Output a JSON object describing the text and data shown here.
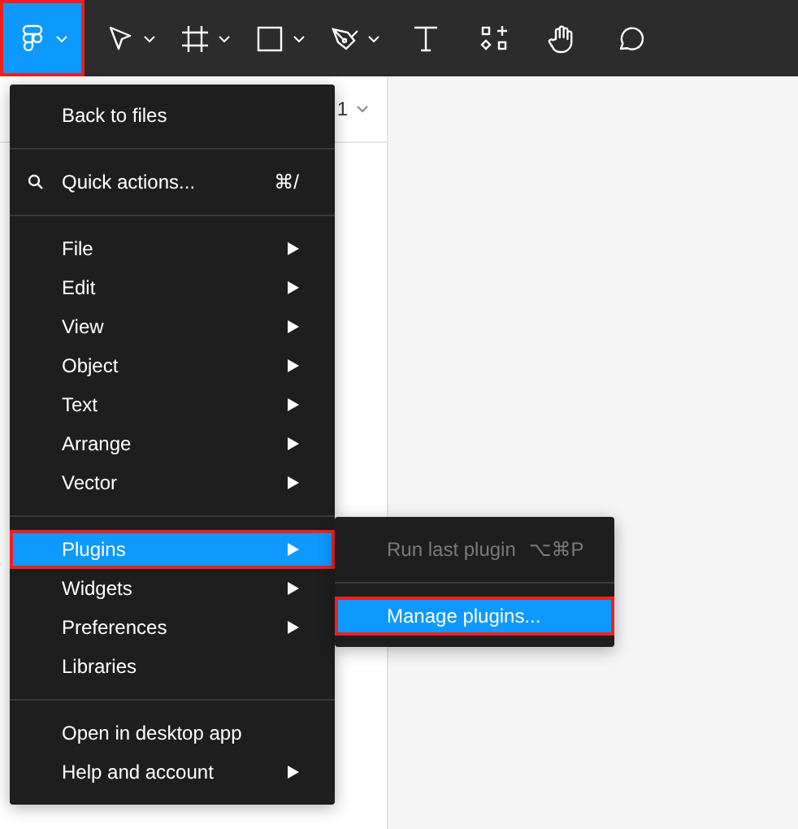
{
  "toolbar": {
    "tools": [
      {
        "kind": "logo",
        "has_menu": true,
        "selected": true,
        "annotated": true
      },
      {
        "kind": "move",
        "has_menu": true,
        "selected": false,
        "annotated": false
      },
      {
        "kind": "frame",
        "has_menu": true,
        "selected": false,
        "annotated": false
      },
      {
        "kind": "rectangle",
        "has_menu": true,
        "selected": false,
        "annotated": false
      },
      {
        "kind": "pen",
        "has_menu": true,
        "selected": false,
        "annotated": false
      },
      {
        "kind": "text",
        "has_menu": false,
        "selected": false,
        "annotated": false
      },
      {
        "kind": "resources",
        "has_menu": false,
        "selected": false,
        "annotated": false
      },
      {
        "kind": "hand",
        "has_menu": false,
        "selected": false,
        "annotated": false
      },
      {
        "kind": "comment",
        "has_menu": false,
        "selected": false,
        "annotated": false
      }
    ]
  },
  "panel": {
    "page_label": "1"
  },
  "menu": {
    "sections": [
      [
        {
          "label": "Back to files",
          "submenu": false,
          "selected": false,
          "annotated": false
        }
      ],
      [
        {
          "label": "Quick actions...",
          "kind": "search",
          "shortcut": "⌘/",
          "submenu": false,
          "selected": false,
          "annotated": false
        }
      ],
      [
        {
          "label": "File",
          "submenu": true,
          "selected": false,
          "annotated": false
        },
        {
          "label": "Edit",
          "submenu": true,
          "selected": false,
          "annotated": false
        },
        {
          "label": "View",
          "submenu": true,
          "selected": false,
          "annotated": false
        },
        {
          "label": "Object",
          "submenu": true,
          "selected": false,
          "annotated": false
        },
        {
          "label": "Text",
          "submenu": true,
          "selected": false,
          "annotated": false
        },
        {
          "label": "Arrange",
          "submenu": true,
          "selected": false,
          "annotated": false
        },
        {
          "label": "Vector",
          "submenu": true,
          "selected": false,
          "annotated": false
        }
      ],
      [
        {
          "label": "Plugins",
          "submenu": true,
          "selected": true,
          "annotated": true
        },
        {
          "label": "Widgets",
          "submenu": true,
          "selected": false,
          "annotated": false
        },
        {
          "label": "Preferences",
          "submenu": true,
          "selected": false,
          "annotated": false
        },
        {
          "label": "Libraries",
          "submenu": false,
          "selected": false,
          "annotated": false
        }
      ],
      [
        {
          "label": "Open in desktop app",
          "submenu": false,
          "selected": false,
          "annotated": false
        },
        {
          "label": "Help and account",
          "submenu": true,
          "selected": false,
          "annotated": false
        }
      ]
    ]
  },
  "submenu": {
    "sections": [
      [
        {
          "label": "Run last plugin",
          "shortcut": "⌥⌘P",
          "disabled": true,
          "selected": false,
          "annotated": false
        }
      ],
      [
        {
          "label": "Manage plugins...",
          "disabled": false,
          "selected": true,
          "annotated": true
        }
      ]
    ]
  }
}
